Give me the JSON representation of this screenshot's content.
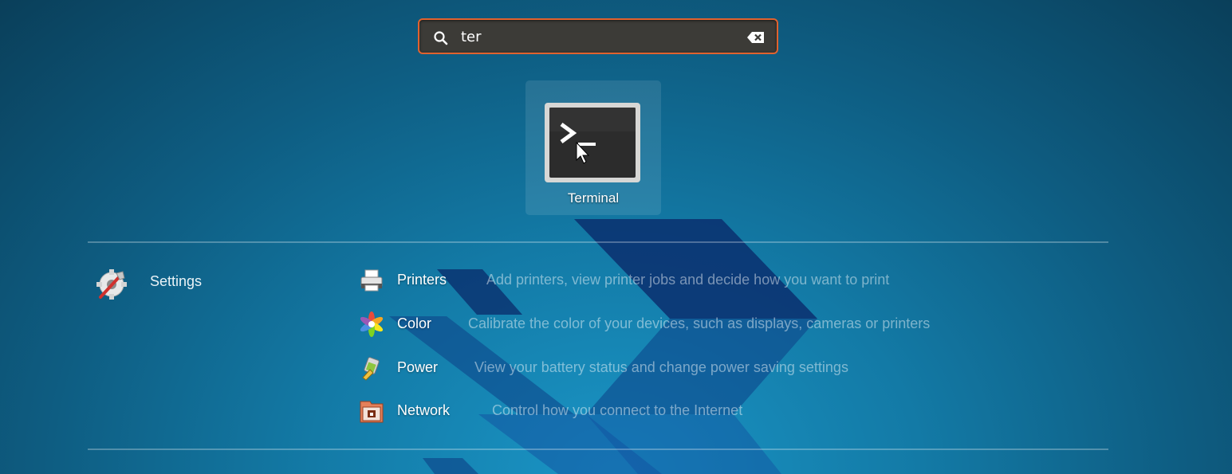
{
  "search": {
    "value": "ter",
    "placeholder": ""
  },
  "apps": [
    {
      "label": "Terminal",
      "icon": "terminal-icon"
    }
  ],
  "settings_group": {
    "label": "Settings",
    "icon": "settings-icon",
    "items": [
      {
        "name": "Printers",
        "description": "Add printers, view printer jobs and decide how you want to print",
        "icon": "printer-icon"
      },
      {
        "name": "Color",
        "description": "Calibrate the color of your devices, such as displays, cameras or printers",
        "icon": "color-icon"
      },
      {
        "name": "Power",
        "description": "View your battery status and change power saving settings",
        "icon": "power-icon"
      },
      {
        "name": "Network",
        "description": "Control how you connect to the Internet",
        "icon": "network-icon"
      }
    ]
  },
  "colors": {
    "search_border": "#e0622f",
    "search_bg": "#3c3b37"
  }
}
